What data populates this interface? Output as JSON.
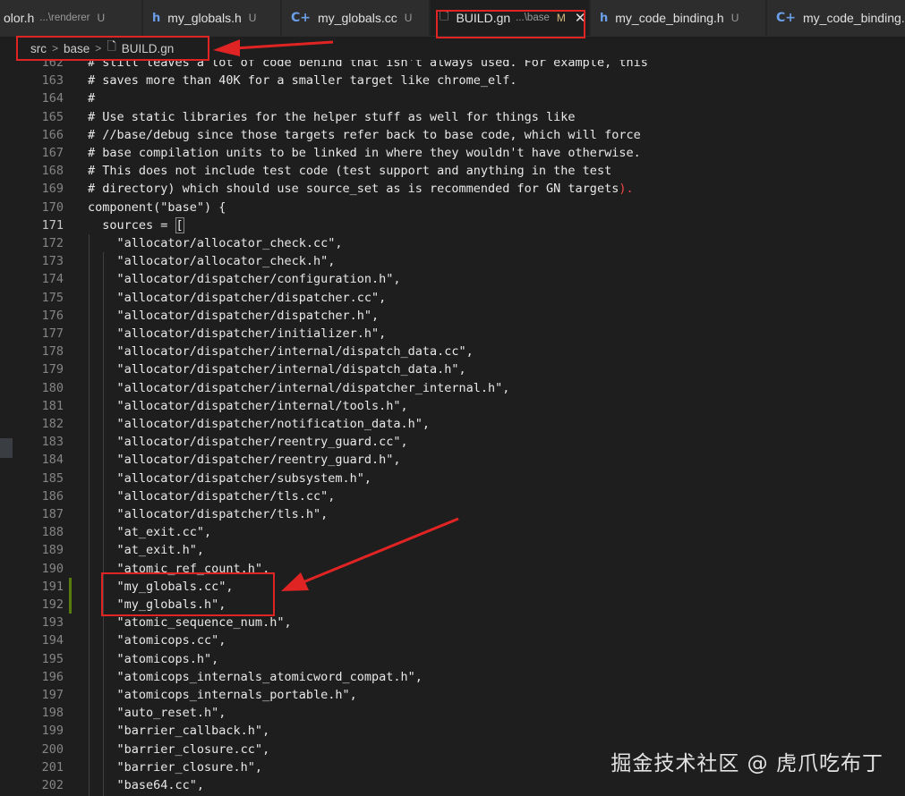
{
  "tabs": [
    {
      "icon": "",
      "label": "olor.h",
      "desc": "...\\renderer",
      "status": "U",
      "active": false
    },
    {
      "icon": "h",
      "label": "my_globals.h",
      "desc": "",
      "status": "U",
      "active": false
    },
    {
      "icon": "C+",
      "label": "my_globals.cc",
      "desc": "",
      "status": "U",
      "active": false
    },
    {
      "icon": "",
      "label": "BUILD.gn",
      "desc": "...\\base",
      "status": "M",
      "close": "✕",
      "active": true
    },
    {
      "icon": "h",
      "label": "my_code_binding.h",
      "desc": "",
      "status": "U",
      "active": false
    },
    {
      "icon": "C+",
      "label": "my_code_binding.cc",
      "desc": "",
      "status": "",
      "active": false
    }
  ],
  "breadcrumb": {
    "parts": [
      "src",
      "base"
    ],
    "file_label": "BUILD.gn",
    "separator": ">"
  },
  "editor": {
    "current_line": "171",
    "lines": [
      {
        "n": "162",
        "t": "# still leaves a lot of code behind that isn't always used. For example, this"
      },
      {
        "n": "163",
        "t": "# saves more than 40K for a smaller target like chrome_elf."
      },
      {
        "n": "164",
        "t": "#"
      },
      {
        "n": "165",
        "t": "# Use static libraries for the helper stuff as well for things like"
      },
      {
        "n": "166",
        "t": "# //base/debug since those targets refer back to base code, which will force"
      },
      {
        "n": "167",
        "t": "# base compilation units to be linked in where they wouldn't have otherwise."
      },
      {
        "n": "168",
        "t": "# This does not include test code (test support and anything in the test"
      },
      {
        "n": "169",
        "t": "# directory) which should use source_set as is recommended for GN targets"
      },
      {
        "n": "170",
        "t": "component(\"base\") {"
      },
      {
        "n": "171",
        "t": "  sources = "
      },
      {
        "n": "172",
        "t": "    \"allocator/allocator_check.cc\","
      },
      {
        "n": "173",
        "t": "    \"allocator/allocator_check.h\","
      },
      {
        "n": "174",
        "t": "    \"allocator/dispatcher/configuration.h\","
      },
      {
        "n": "175",
        "t": "    \"allocator/dispatcher/dispatcher.cc\","
      },
      {
        "n": "176",
        "t": "    \"allocator/dispatcher/dispatcher.h\","
      },
      {
        "n": "177",
        "t": "    \"allocator/dispatcher/initializer.h\","
      },
      {
        "n": "178",
        "t": "    \"allocator/dispatcher/internal/dispatch_data.cc\","
      },
      {
        "n": "179",
        "t": "    \"allocator/dispatcher/internal/dispatch_data.h\","
      },
      {
        "n": "180",
        "t": "    \"allocator/dispatcher/internal/dispatcher_internal.h\","
      },
      {
        "n": "181",
        "t": "    \"allocator/dispatcher/internal/tools.h\","
      },
      {
        "n": "182",
        "t": "    \"allocator/dispatcher/notification_data.h\","
      },
      {
        "n": "183",
        "t": "    \"allocator/dispatcher/reentry_guard.cc\","
      },
      {
        "n": "184",
        "t": "    \"allocator/dispatcher/reentry_guard.h\","
      },
      {
        "n": "185",
        "t": "    \"allocator/dispatcher/subsystem.h\","
      },
      {
        "n": "186",
        "t": "    \"allocator/dispatcher/tls.cc\","
      },
      {
        "n": "187",
        "t": "    \"allocator/dispatcher/tls.h\","
      },
      {
        "n": "188",
        "t": "    \"at_exit.cc\","
      },
      {
        "n": "189",
        "t": "    \"at_exit.h\","
      },
      {
        "n": "190",
        "t": "    \"atomic_ref_count.h\","
      },
      {
        "n": "191",
        "t": "    \"my_globals.cc\","
      },
      {
        "n": "192",
        "t": "    \"my_globals.h\","
      },
      {
        "n": "193",
        "t": "    \"atomic_sequence_num.h\","
      },
      {
        "n": "194",
        "t": "    \"atomicops.cc\","
      },
      {
        "n": "195",
        "t": "    \"atomicops.h\","
      },
      {
        "n": "196",
        "t": "    \"atomicops_internals_atomicword_compat.h\","
      },
      {
        "n": "197",
        "t": "    \"atomicops_internals_portable.h\","
      },
      {
        "n": "198",
        "t": "    \"auto_reset.h\","
      },
      {
        "n": "199",
        "t": "    \"barrier_callback.h\","
      },
      {
        "n": "200",
        "t": "    \"barrier_closure.cc\","
      },
      {
        "n": "201",
        "t": "    \"barrier_closure.h\","
      },
      {
        "n": "202",
        "t": "    \"base64.cc\","
      }
    ],
    "line169_paren": ").",
    "line171_bracket": "["
  },
  "watermark": "掘金技术社区 @ 虎爪吃布丁",
  "colors": {
    "annotation_red": "#e02424",
    "git_added": "#587c0c",
    "editor_bg": "#1e1e1e"
  }
}
